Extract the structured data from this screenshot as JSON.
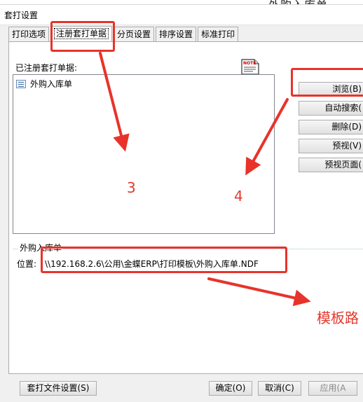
{
  "background_text": "外购入库单",
  "window": {
    "title": "套打设置"
  },
  "tabs": [
    {
      "label": "打印选项"
    },
    {
      "label": "注册套打单据"
    },
    {
      "label": "分页设置"
    },
    {
      "label": "排序设置"
    },
    {
      "label": "标准打印"
    }
  ],
  "registered": {
    "label": "已注册套打单据:",
    "items": [
      {
        "label": "外购入库单",
        "icon": "document-list-icon"
      }
    ],
    "note_icon_text": "NOTE"
  },
  "side_buttons": {
    "browse": "浏览(B)",
    "auto_search": "自动搜索(",
    "delete": "删除(D)",
    "preview": "预视(V)",
    "preview_page": "预视页面("
  },
  "group": {
    "title": "外购入库单",
    "location_label": "位置:",
    "location_value": "\\\\192.168.2.6\\公用\\金蝶ERP\\打印模板\\外购入库单.NDF"
  },
  "bottom_buttons": {
    "template_settings": "套打文件设置(S)",
    "ok": "确定(O)",
    "cancel": "取消(C)",
    "apply": "应用(A"
  },
  "annotations": {
    "step3": "3",
    "step4": "4",
    "template_path": "模板路",
    "highlight_color": "#e8332a"
  }
}
